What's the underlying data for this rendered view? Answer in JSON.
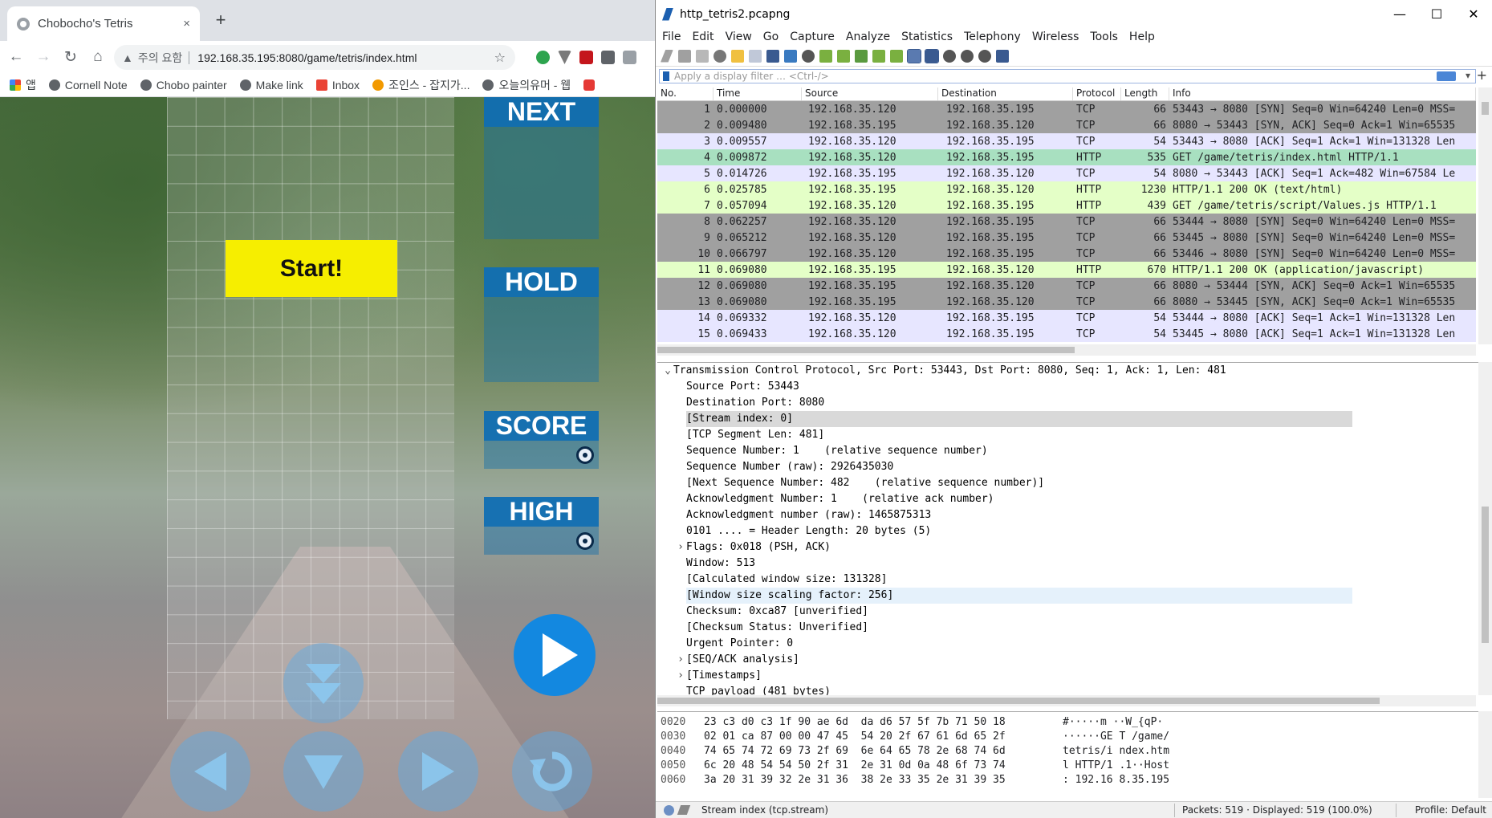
{
  "chrome": {
    "tab_title": "Chobocho's Tetris",
    "tab_close": "×",
    "new_tab": "+",
    "security_warning": "주의 요함",
    "url": "192.168.35.195:8080/game/tetris/index.html",
    "bookmarks": [
      "앱",
      "Cornell Note",
      "Chobo painter",
      "Make link",
      "Inbox",
      "조인스 - 잡지가...",
      "오늘의유머 - 웹"
    ]
  },
  "game": {
    "start_label": "Start!",
    "next_label": "NEXT",
    "hold_label": "HOLD",
    "score_label": "SCORE",
    "high_label": "HIGH"
  },
  "wireshark": {
    "window_title": "http_tetris2.pcapng",
    "menu": [
      "File",
      "Edit",
      "View",
      "Go",
      "Capture",
      "Analyze",
      "Statistics",
      "Telephony",
      "Wireless",
      "Tools",
      "Help"
    ],
    "filter_placeholder": "Apply a display filter … <Ctrl-/>",
    "columns": [
      "No.",
      "Time",
      "Source",
      "Destination",
      "Protocol",
      "Length",
      "Info"
    ],
    "colors": {
      "tcp_gray": "#a0a0a0",
      "tcp_lav": "#e7e6ff",
      "http_green": "#e4ffc7",
      "selected": "#a8e0c0"
    },
    "packets": [
      {
        "no": "1",
        "time": "0.000000",
        "src": "192.168.35.120",
        "dst": "192.168.35.195",
        "proto": "TCP",
        "len": "66",
        "info": "53443 → 8080 [SYN] Seq=0 Win=64240 Len=0 MSS=",
        "style": "gray"
      },
      {
        "no": "2",
        "time": "0.009480",
        "src": "192.168.35.195",
        "dst": "192.168.35.120",
        "proto": "TCP",
        "len": "66",
        "info": "8080 → 53443 [SYN, ACK] Seq=0 Ack=1 Win=65535",
        "style": "gray"
      },
      {
        "no": "3",
        "time": "0.009557",
        "src": "192.168.35.120",
        "dst": "192.168.35.195",
        "proto": "TCP",
        "len": "54",
        "info": "53443 → 8080 [ACK] Seq=1 Ack=1 Win=131328 Len",
        "style": "lav"
      },
      {
        "no": "4",
        "time": "0.009872",
        "src": "192.168.35.120",
        "dst": "192.168.35.195",
        "proto": "HTTP",
        "len": "535",
        "info": "GET /game/tetris/index.html HTTP/1.1",
        "style": "sel"
      },
      {
        "no": "5",
        "time": "0.014726",
        "src": "192.168.35.195",
        "dst": "192.168.35.120",
        "proto": "TCP",
        "len": "54",
        "info": "8080 → 53443 [ACK] Seq=1 Ack=482 Win=67584 Le",
        "style": "lav"
      },
      {
        "no": "6",
        "time": "0.025785",
        "src": "192.168.35.195",
        "dst": "192.168.35.120",
        "proto": "HTTP",
        "len": "1230",
        "info": "HTTP/1.1 200 OK  (text/html)",
        "style": "green"
      },
      {
        "no": "7",
        "time": "0.057094",
        "src": "192.168.35.120",
        "dst": "192.168.35.195",
        "proto": "HTTP",
        "len": "439",
        "info": "GET /game/tetris/script/Values.js HTTP/1.1",
        "style": "green"
      },
      {
        "no": "8",
        "time": "0.062257",
        "src": "192.168.35.120",
        "dst": "192.168.35.195",
        "proto": "TCP",
        "len": "66",
        "info": "53444 → 8080 [SYN] Seq=0 Win=64240 Len=0 MSS=",
        "style": "gray"
      },
      {
        "no": "9",
        "time": "0.065212",
        "src": "192.168.35.120",
        "dst": "192.168.35.195",
        "proto": "TCP",
        "len": "66",
        "info": "53445 → 8080 [SYN] Seq=0 Win=64240 Len=0 MSS=",
        "style": "gray"
      },
      {
        "no": "10",
        "time": "0.066797",
        "src": "192.168.35.120",
        "dst": "192.168.35.195",
        "proto": "TCP",
        "len": "66",
        "info": "53446 → 8080 [SYN] Seq=0 Win=64240 Len=0 MSS=",
        "style": "gray"
      },
      {
        "no": "11",
        "time": "0.069080",
        "src": "192.168.35.195",
        "dst": "192.168.35.120",
        "proto": "HTTP",
        "len": "670",
        "info": "HTTP/1.1 200 OK  (application/javascript)",
        "style": "green"
      },
      {
        "no": "12",
        "time": "0.069080",
        "src": "192.168.35.195",
        "dst": "192.168.35.120",
        "proto": "TCP",
        "len": "66",
        "info": "8080 → 53444 [SYN, ACK] Seq=0 Ack=1 Win=65535",
        "style": "gray"
      },
      {
        "no": "13",
        "time": "0.069080",
        "src": "192.168.35.195",
        "dst": "192.168.35.120",
        "proto": "TCP",
        "len": "66",
        "info": "8080 → 53445 [SYN, ACK] Seq=0 Ack=1 Win=65535",
        "style": "gray"
      },
      {
        "no": "14",
        "time": "0.069332",
        "src": "192.168.35.120",
        "dst": "192.168.35.195",
        "proto": "TCP",
        "len": "54",
        "info": "53444 → 8080 [ACK] Seq=1 Ack=1 Win=131328 Len",
        "style": "lav"
      },
      {
        "no": "15",
        "time": "0.069433",
        "src": "192.168.35.120",
        "dst": "192.168.35.195",
        "proto": "TCP",
        "len": "54",
        "info": "53445 → 8080 [ACK] Seq=1 Ack=1 Win=131328 Len",
        "style": "lav"
      }
    ],
    "details": [
      {
        "t": "v",
        "text": "Transmission Control Protocol, Src Port: 53443, Dst Port: 8080, Seq: 1, Ack: 1, Len: 481",
        "indent": 0,
        "style": ""
      },
      {
        "t": "",
        "text": "Source Port: 53443",
        "indent": 1,
        "style": ""
      },
      {
        "t": "",
        "text": "Destination Port: 8080",
        "indent": 1,
        "style": ""
      },
      {
        "t": "",
        "text": "[Stream index: 0]",
        "indent": 1,
        "style": "sel"
      },
      {
        "t": "",
        "text": "[TCP Segment Len: 481]",
        "indent": 1,
        "style": ""
      },
      {
        "t": "",
        "text": "Sequence Number: 1    (relative sequence number)",
        "indent": 1,
        "style": ""
      },
      {
        "t": "",
        "text": "Sequence Number (raw): 2926435030",
        "indent": 1,
        "style": ""
      },
      {
        "t": "",
        "text": "[Next Sequence Number: 482    (relative sequence number)]",
        "indent": 1,
        "style": ""
      },
      {
        "t": "",
        "text": "Acknowledgment Number: 1    (relative ack number)",
        "indent": 1,
        "style": ""
      },
      {
        "t": "",
        "text": "Acknowledgment number (raw): 1465875313",
        "indent": 1,
        "style": ""
      },
      {
        "t": "",
        "text": "0101 .... = Header Length: 20 bytes (5)",
        "indent": 1,
        "style": ""
      },
      {
        "t": ">",
        "text": "Flags: 0x018 (PSH, ACK)",
        "indent": 1,
        "style": ""
      },
      {
        "t": "",
        "text": "Window: 513",
        "indent": 1,
        "style": ""
      },
      {
        "t": "",
        "text": "[Calculated window size: 131328]",
        "indent": 1,
        "style": ""
      },
      {
        "t": "",
        "text": "[Window size scaling factor: 256]",
        "indent": 1,
        "style": "hl"
      },
      {
        "t": "",
        "text": "Checksum: 0xca87 [unverified]",
        "indent": 1,
        "style": ""
      },
      {
        "t": "",
        "text": "[Checksum Status: Unverified]",
        "indent": 1,
        "style": ""
      },
      {
        "t": "",
        "text": "Urgent Pointer: 0",
        "indent": 1,
        "style": ""
      },
      {
        "t": ">",
        "text": "[SEQ/ACK analysis]",
        "indent": 1,
        "style": ""
      },
      {
        "t": ">",
        "text": "[Timestamps]",
        "indent": 1,
        "style": ""
      },
      {
        "t": "",
        "text": "TCP payload (481 bytes)",
        "indent": 1,
        "style": ""
      }
    ],
    "hex": [
      {
        "off": "0020",
        "hex": "23 c3 d0 c3 1f 90 ae 6d  da d6 57 5f 7b 71 50 18",
        "ascii": "#·····m ··W_{qP·"
      },
      {
        "off": "0030",
        "hex": "02 01 ca 87 00 00 47 45  54 20 2f 67 61 6d 65 2f",
        "ascii": "······GE T /game/"
      },
      {
        "off": "0040",
        "hex": "74 65 74 72 69 73 2f 69  6e 64 65 78 2e 68 74 6d",
        "ascii": "tetris/i ndex.htm"
      },
      {
        "off": "0050",
        "hex": "6c 20 48 54 54 50 2f 31  2e 31 0d 0a 48 6f 73 74",
        "ascii": "l HTTP/1 .1··Host"
      },
      {
        "off": "0060",
        "hex": "3a 20 31 39 32 2e 31 36  38 2e 33 35 2e 31 39 35",
        "ascii": ": 192.16 8.35.195"
      }
    ],
    "status": {
      "field": "Stream index (tcp.stream)",
      "packets": "Packets: 519 · Displayed: 519 (100.0%)",
      "profile": "Profile: Default"
    }
  }
}
